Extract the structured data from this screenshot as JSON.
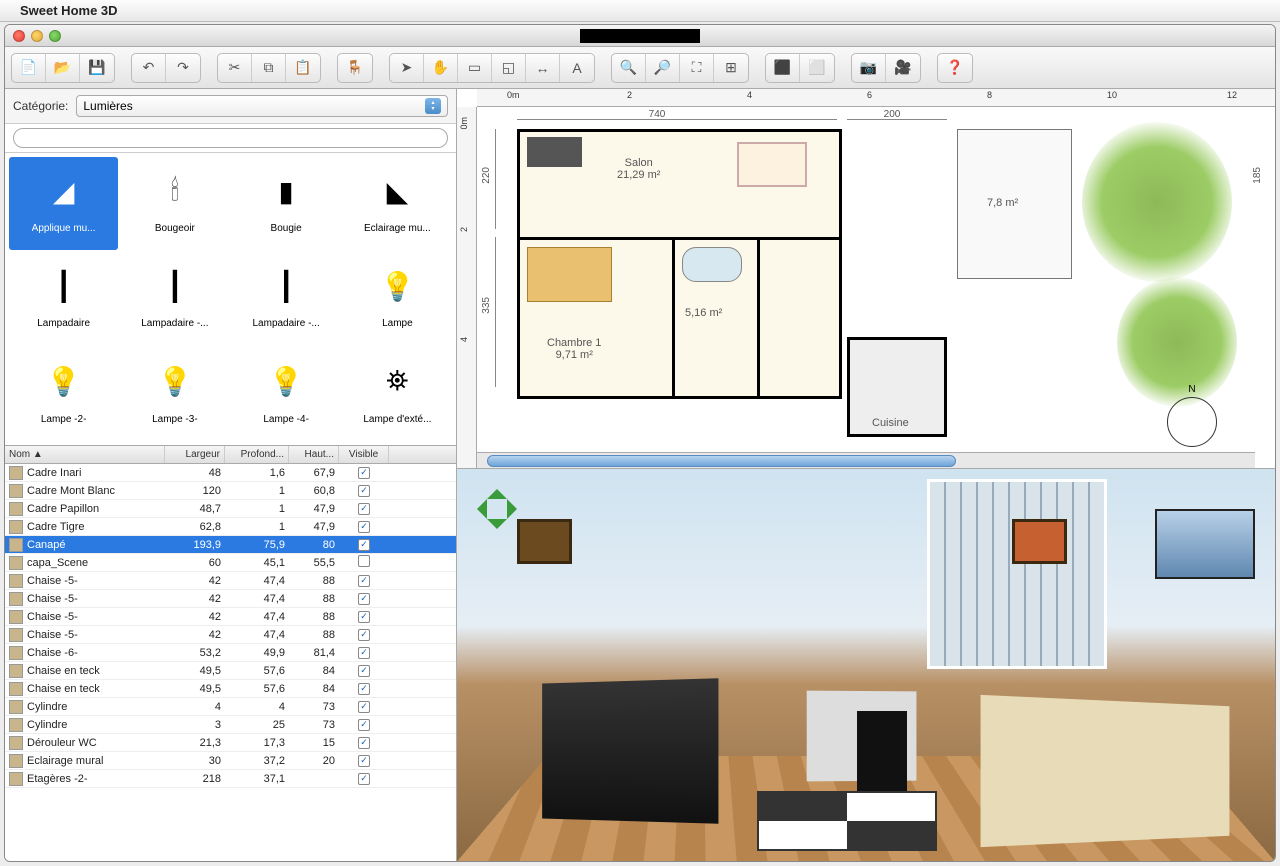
{
  "menubar": {
    "app_name": "Sweet Home 3D"
  },
  "window": {
    "title_redacted": true
  },
  "catalog": {
    "category_label": "Catégorie:",
    "category_value": "Lumières",
    "search_placeholder": "",
    "items": [
      {
        "label": "Applique mu...",
        "selected": true,
        "icon": "wall-lamp-icon"
      },
      {
        "label": "Bougeoir",
        "selected": false,
        "icon": "candelabra-icon"
      },
      {
        "label": "Bougie",
        "selected": false,
        "icon": "candle-icon"
      },
      {
        "label": "Eclairage mu...",
        "selected": false,
        "icon": "wall-light-icon"
      },
      {
        "label": "Lampadaire",
        "selected": false,
        "icon": "floor-lamp-icon"
      },
      {
        "label": "Lampadaire -...",
        "selected": false,
        "icon": "floor-lamp-icon"
      },
      {
        "label": "Lampadaire -...",
        "selected": false,
        "icon": "floor-lamp-icon"
      },
      {
        "label": "Lampe",
        "selected": false,
        "icon": "lamp-icon"
      },
      {
        "label": "Lampe -2-",
        "selected": false,
        "icon": "lamp-icon"
      },
      {
        "label": "Lampe -3-",
        "selected": false,
        "icon": "lamp-icon"
      },
      {
        "label": "Lampe -4-",
        "selected": false,
        "icon": "lamp-icon"
      },
      {
        "label": "Lampe d'exté...",
        "selected": false,
        "icon": "outdoor-lamp-icon"
      }
    ]
  },
  "furniture_table": {
    "columns": {
      "name": "Nom ▲",
      "width": "Largeur",
      "depth": "Profond...",
      "height": "Haut...",
      "visible": "Visible"
    },
    "rows": [
      {
        "name": "Cadre Inari",
        "w": "48",
        "d": "1,6",
        "h": "67,9",
        "v": true,
        "selected": false
      },
      {
        "name": "Cadre Mont Blanc",
        "w": "120",
        "d": "1",
        "h": "60,8",
        "v": true,
        "selected": false
      },
      {
        "name": "Cadre Papillon",
        "w": "48,7",
        "d": "1",
        "h": "47,9",
        "v": true,
        "selected": false
      },
      {
        "name": "Cadre Tigre",
        "w": "62,8",
        "d": "1",
        "h": "47,9",
        "v": true,
        "selected": false
      },
      {
        "name": "Canapé",
        "w": "193,9",
        "d": "75,9",
        "h": "80",
        "v": true,
        "selected": true
      },
      {
        "name": "capa_Scene",
        "w": "60",
        "d": "45,1",
        "h": "55,5",
        "v": false,
        "selected": false
      },
      {
        "name": "Chaise -5-",
        "w": "42",
        "d": "47,4",
        "h": "88",
        "v": true,
        "selected": false
      },
      {
        "name": "Chaise -5-",
        "w": "42",
        "d": "47,4",
        "h": "88",
        "v": true,
        "selected": false
      },
      {
        "name": "Chaise -5-",
        "w": "42",
        "d": "47,4",
        "h": "88",
        "v": true,
        "selected": false
      },
      {
        "name": "Chaise -5-",
        "w": "42",
        "d": "47,4",
        "h": "88",
        "v": true,
        "selected": false
      },
      {
        "name": "Chaise -6-",
        "w": "53,2",
        "d": "49,9",
        "h": "81,4",
        "v": true,
        "selected": false
      },
      {
        "name": "Chaise en teck",
        "w": "49,5",
        "d": "57,6",
        "h": "84",
        "v": true,
        "selected": false
      },
      {
        "name": "Chaise en teck",
        "w": "49,5",
        "d": "57,6",
        "h": "84",
        "v": true,
        "selected": false
      },
      {
        "name": "Cylindre",
        "w": "4",
        "d": "4",
        "h": "73",
        "v": true,
        "selected": false
      },
      {
        "name": "Cylindre",
        "w": "3",
        "d": "25",
        "h": "73",
        "v": true,
        "selected": false
      },
      {
        "name": "Dérouleur WC",
        "w": "21,3",
        "d": "17,3",
        "h": "15",
        "v": true,
        "selected": false
      },
      {
        "name": "Eclairage mural",
        "w": "30",
        "d": "37,2",
        "h": "20",
        "v": true,
        "selected": false
      },
      {
        "name": "Etagères -2-",
        "w": "218",
        "d": "37,1",
        "h": "",
        "v": true,
        "selected": false
      }
    ]
  },
  "plan": {
    "ruler_h": [
      "0m",
      "2",
      "4",
      "6",
      "8",
      "10",
      "12"
    ],
    "ruler_v": [
      "0m",
      "2",
      "4"
    ],
    "dims": {
      "w1": "740",
      "w2": "200",
      "h1": "220",
      "h2": "335",
      "h3": "185"
    },
    "rooms": [
      {
        "name": "Salon",
        "area": "21,29 m²"
      },
      {
        "name": "Chambre 1",
        "area": "9,71 m²"
      },
      {
        "name": "",
        "area": "5,16 m²"
      },
      {
        "name": "",
        "area": "7,8 m²"
      },
      {
        "name": "Cuisine",
        "area": ""
      }
    ],
    "compass": "N"
  }
}
